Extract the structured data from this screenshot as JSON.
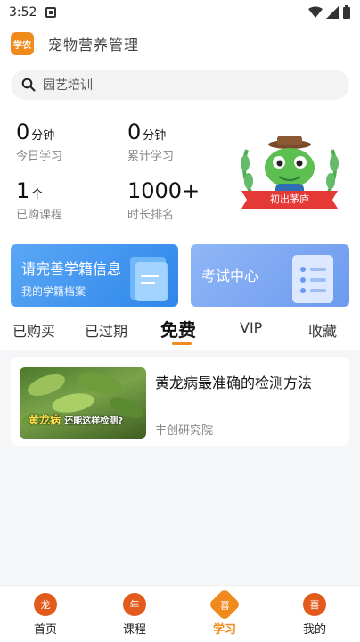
{
  "status_bar": {
    "time": "3:52"
  },
  "header": {
    "logo_text": "学农",
    "title": "宠物营养管理"
  },
  "search": {
    "placeholder": "园艺培训"
  },
  "stats": [
    {
      "value": "0",
      "unit": "分钟",
      "label": "今日学习"
    },
    {
      "value": "0",
      "unit": "分钟",
      "label": "累计学习"
    },
    {
      "value": "1",
      "unit": "个",
      "label": "已购课程"
    },
    {
      "value": "1000+",
      "unit": "",
      "label": "时长排名"
    }
  ],
  "badge": {
    "text": "初出茅庐"
  },
  "cards": {
    "profile": {
      "title": "请完善学籍信息",
      "subtitle": "我的学籍档案"
    },
    "exam": {
      "title": "考试中心"
    }
  },
  "tabs": [
    "已购买",
    "已过期",
    "免费",
    "VIP",
    "收藏"
  ],
  "active_tab": "免费",
  "courses": [
    {
      "title": "黄龙病最准确的检测方法",
      "org": "丰创研究院",
      "thumb_main": "黄龙病",
      "thumb_sub": "还能这样检测?"
    }
  ],
  "bottom_nav": [
    {
      "label": "首页",
      "icon_text": "龙"
    },
    {
      "label": "课程",
      "icon_text": "年"
    },
    {
      "label": "学习",
      "icon_text": "喜"
    },
    {
      "label": "我的",
      "icon_text": "喜"
    }
  ],
  "colors": {
    "accent": "#f08a1c",
    "card_blue": "#2f86ea",
    "card_light_blue": "#6d9aef"
  }
}
